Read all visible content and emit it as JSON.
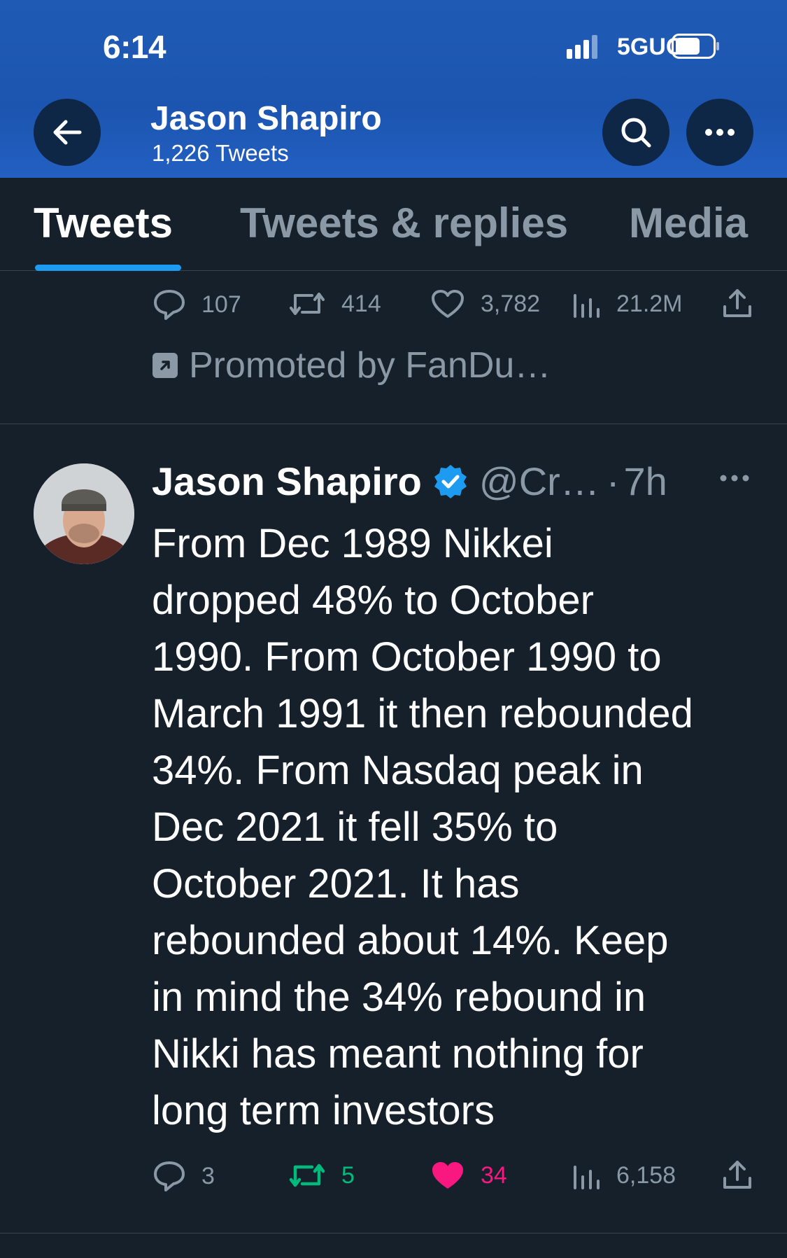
{
  "status_bar": {
    "time": "6:14",
    "network": "5GUC"
  },
  "header": {
    "name": "Jason Shapiro",
    "tweet_count": "1,226 Tweets"
  },
  "tabs": [
    {
      "label": "Tweets",
      "active": true
    },
    {
      "label": "Tweets & replies",
      "active": false
    },
    {
      "label": "Media",
      "active": false
    }
  ],
  "previous_tweet": {
    "replies": "107",
    "retweets": "414",
    "likes": "3,782",
    "views": "21.2M",
    "promoted": "Promoted by FanDu…"
  },
  "tweet": {
    "name": "Jason Shapiro",
    "handle": "@Cr…",
    "separator": "·",
    "time": "7h",
    "text": "From Dec 1989 Nikkei\ndropped 48% to October\n1990.  From October 1990 to\nMarch 1991 it then rebounded\n34%.  From Nasdaq peak in\nDec 2021 it fell 35% to\nOctober 2021.  It has\nrebounded about 14%.  Keep\nin mind the 34% rebound in\nNikki has meant nothing for\nlong term investors",
    "replies": "3",
    "retweets": "5",
    "likes": "34",
    "views": "6,158"
  },
  "colors": {
    "background": "#15202b",
    "header": "#1f5bb5",
    "accent": "#1d9bf0",
    "retweet_green": "#00ba7c",
    "like_pink": "#f91880",
    "muted": "#8b98a5"
  }
}
